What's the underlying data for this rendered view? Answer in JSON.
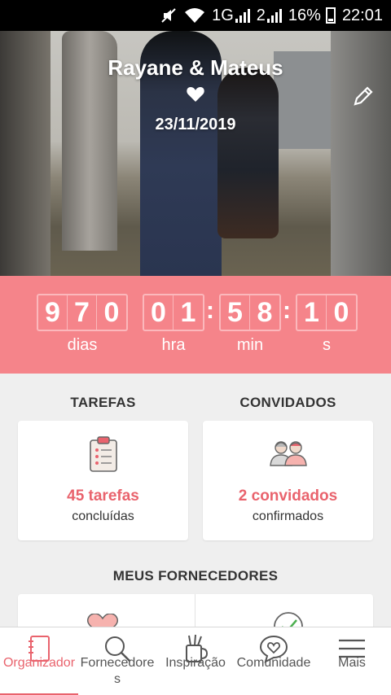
{
  "status_bar": {
    "network_1": "1G",
    "network_2": "2",
    "battery": "16%",
    "time": "22:01",
    "icons": [
      "mute-icon",
      "wifi-icon",
      "signal-icon",
      "battery-icon"
    ]
  },
  "hero": {
    "title": "Rayane & Mateus",
    "date": "23/11/2019",
    "heart_icon": "heart-icon",
    "edit_icon": "pencil-icon"
  },
  "countdown": {
    "days": [
      "9",
      "7",
      "0"
    ],
    "hours": [
      "0",
      "1"
    ],
    "minutes": [
      "5",
      "8"
    ],
    "seconds": [
      "1",
      "0"
    ],
    "separator": ":",
    "labels": {
      "days": "dias",
      "hours": "hra",
      "minutes": "min",
      "seconds": "s"
    },
    "color": "#f5848a"
  },
  "tasks": {
    "heading": "TAREFAS",
    "count": "45 tarefas",
    "sub": "concluídas",
    "icon": "clipboard-checklist-icon"
  },
  "guests": {
    "heading": "CONVIDADOS",
    "count": "2 convidados",
    "sub": "confirmados",
    "icon": "couple-icon"
  },
  "vendors": {
    "heading": "MEUS FORNECEDORES",
    "icons": [
      "heart-vendor-icon",
      "check-circle-icon"
    ]
  },
  "bottom_nav": {
    "items": [
      {
        "label": "Organizador",
        "icon": "notebook-icon"
      },
      {
        "label": "Fornecedores",
        "icon": "search-icon"
      },
      {
        "label": "Inspiração",
        "icon": "mug-pencils-icon"
      },
      {
        "label": "Comunidade",
        "icon": "chat-heart-icon"
      },
      {
        "label": "Mais",
        "icon": "menu-icon"
      }
    ],
    "active_color": "#e9636d"
  }
}
